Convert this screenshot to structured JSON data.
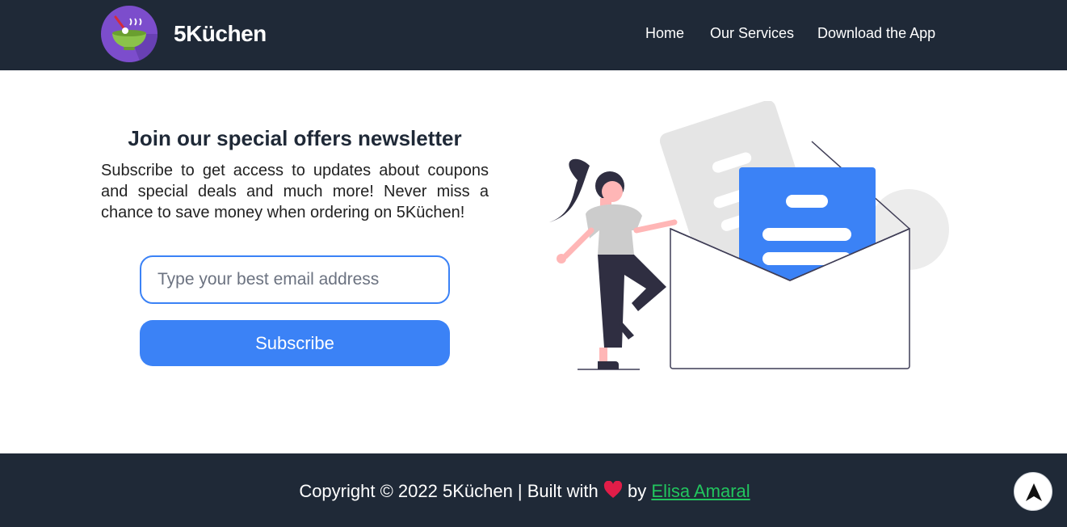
{
  "brand": {
    "name": "5Küchen",
    "logo_icon": "bowl-logo-icon"
  },
  "nav": {
    "items": [
      "Home",
      "Our Services",
      "Download the App"
    ]
  },
  "newsletter": {
    "title": "Join our special offers newsletter",
    "description": "Subscribe to get access to updates about coupons and special deals and much more! Never miss a chance to save money when ordering on 5Küchen!",
    "email_placeholder": "Type your best email address",
    "email_value": "",
    "subscribe_label": "Subscribe",
    "illustration_icon": "mail-envelope-illustration"
  },
  "footer": {
    "prefix": "Copyright © 2022 5Küchen | Built with",
    "by": "by",
    "author": "Elisa Amaral",
    "heart_icon": "heart-icon"
  },
  "scroll_top": {
    "icon": "arrow-up-icon"
  },
  "colors": {
    "header_bg": "#1f2937",
    "accent": "#3b82f6",
    "link": "#22c55e",
    "heart": "#e11d48"
  }
}
